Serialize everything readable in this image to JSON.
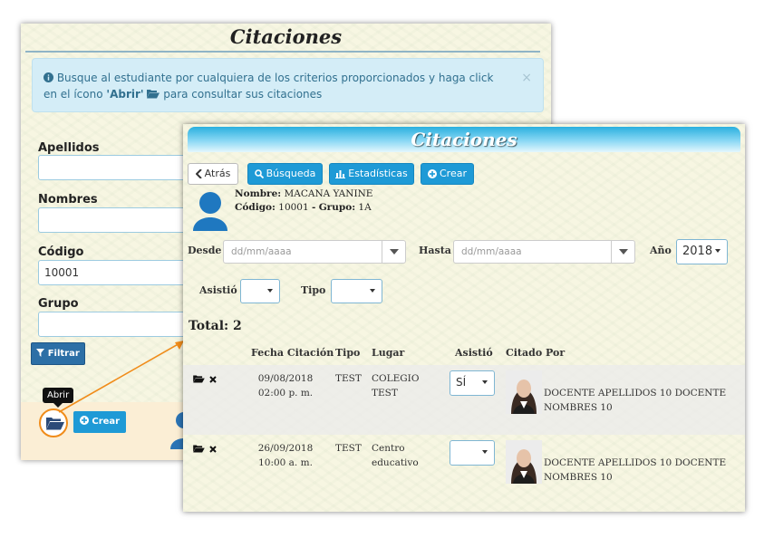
{
  "back": {
    "title": "Citaciones",
    "alert": {
      "text_before": "Busque al estudiante por cualquiera de los criterios proporcionados y haga click en el ícono",
      "abrir": "'Abrir'",
      "text_after": "para consultar sus citaciones",
      "close": "×"
    },
    "fields": {
      "apellidos_label": "Apellidos",
      "nombres_label": "Nombres",
      "codigo_label": "Código",
      "codigo_value": "10001",
      "grupo_label": "Grupo"
    },
    "filtrar_label": "Filtrar",
    "tooltip": "Abrir",
    "crear_label": "Crear"
  },
  "front": {
    "title": "Citaciones",
    "toolbar": {
      "atras": "Atrás",
      "busqueda": "Búsqueda",
      "estadisticas": "Estadísticas",
      "crear": "Crear"
    },
    "student": {
      "nombre_label": "Nombre:",
      "nombre": "MACANA YANINE",
      "codigo_label": "Código:",
      "codigo": "10001",
      "grupo_label": "Grupo:",
      "grupo": "1A"
    },
    "filters": {
      "desde_label": "Desde",
      "desde_placeholder": "dd/mm/aaaa",
      "hasta_label": "Hasta",
      "hasta_placeholder": "dd/mm/aaaa",
      "anio_label": "Año",
      "anio_value": "2018",
      "asistio_label": "Asistió",
      "tipo_label": "Tipo"
    },
    "total": "Total: 2",
    "columns": [
      "Fecha Citación",
      "Tipo",
      "Lugar",
      "Asistió",
      "Citado Por"
    ],
    "rows": [
      {
        "fecha": "09/08/2018",
        "hora": "02:00 p. m.",
        "tipo": "TEST",
        "lugar1": "COLEGIO",
        "lugar2": "TEST",
        "asistio": "SÍ",
        "citado1": "DOCENTE APELLIDOS 10 DOCENTE",
        "citado2": "NOMBRES 10"
      },
      {
        "fecha": "26/09/2018",
        "hora": "10:00 a. m.",
        "tipo": "TEST",
        "lugar1": "Centro",
        "lugar2": "educativo",
        "asistio": "",
        "citado1": "DOCENTE APELLIDOS 10 DOCENTE",
        "citado2": "NOMBRES 10"
      }
    ]
  },
  "colors": {
    "primary": "#1e9ad6",
    "accent_arrow": "#f08c1a",
    "filter_button": "#2c6fa6",
    "alert_bg": "#d4edf7"
  }
}
